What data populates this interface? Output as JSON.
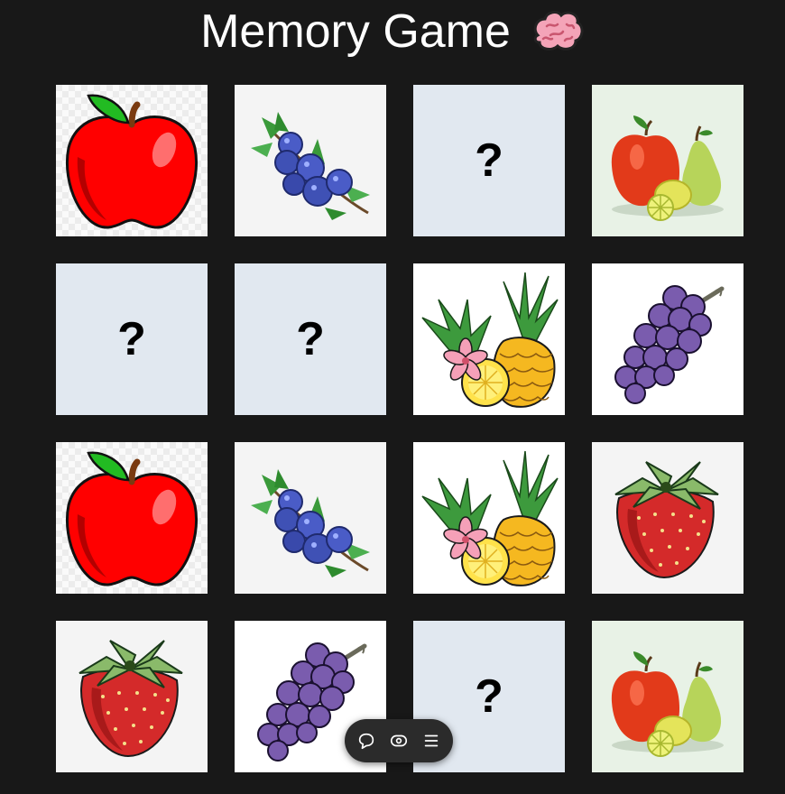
{
  "header": {
    "title": "Memory Game",
    "emoji_icon": "brain-icon"
  },
  "board": {
    "hidden_symbol": "?",
    "cards": [
      {
        "state": "revealed",
        "fruit": "apple"
      },
      {
        "state": "revealed",
        "fruit": "blueberries"
      },
      {
        "state": "hidden"
      },
      {
        "state": "revealed",
        "fruit": "mixed-fruit"
      },
      {
        "state": "hidden"
      },
      {
        "state": "hidden"
      },
      {
        "state": "revealed",
        "fruit": "pineapple"
      },
      {
        "state": "revealed",
        "fruit": "grapes"
      },
      {
        "state": "revealed",
        "fruit": "apple"
      },
      {
        "state": "revealed",
        "fruit": "blueberries"
      },
      {
        "state": "revealed",
        "fruit": "pineapple"
      },
      {
        "state": "revealed",
        "fruit": "strawberry"
      },
      {
        "state": "revealed",
        "fruit": "strawberry"
      },
      {
        "state": "revealed",
        "fruit": "grapes"
      },
      {
        "state": "hidden"
      },
      {
        "state": "revealed",
        "fruit": "mixed-fruit"
      }
    ]
  },
  "toolbar": {
    "items": [
      "chat-bubble-icon",
      "eye-icon",
      "menu-icon"
    ]
  },
  "colors": {
    "background": "#181818",
    "hidden_card": "#e1e8f0"
  }
}
